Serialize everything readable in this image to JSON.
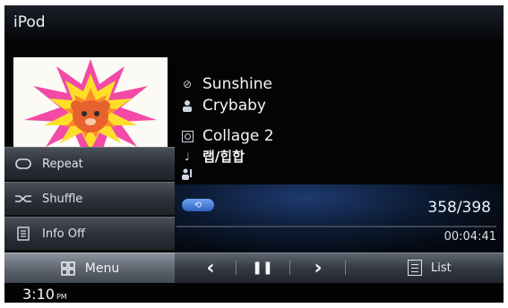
{
  "header": {
    "title": "iPod"
  },
  "track": {
    "title": "Sunshine",
    "artist": "Crybaby",
    "album": "Collage 2",
    "genre": "랩/힙합",
    "composer": ""
  },
  "side_menu": {
    "items": [
      {
        "label": "Repeat",
        "icon": "repeat-icon"
      },
      {
        "label": "Shuffle",
        "icon": "shuffle-icon"
      },
      {
        "label": "Info Off",
        "icon": "info-icon"
      }
    ]
  },
  "playback": {
    "repeat_indicator": "⟲",
    "track_count": "358/398",
    "elapsed": "00:04:41",
    "progress_fraction": 0.0
  },
  "controls": {
    "menu_label": "Menu",
    "prev_label": "‹",
    "pause_label": "❚❚",
    "next_label": "›",
    "list_label": "List"
  },
  "status": {
    "clock": "3:10",
    "ampm": "PM"
  },
  "colors": {
    "accent": "#4a86e0",
    "background": "#040404"
  }
}
